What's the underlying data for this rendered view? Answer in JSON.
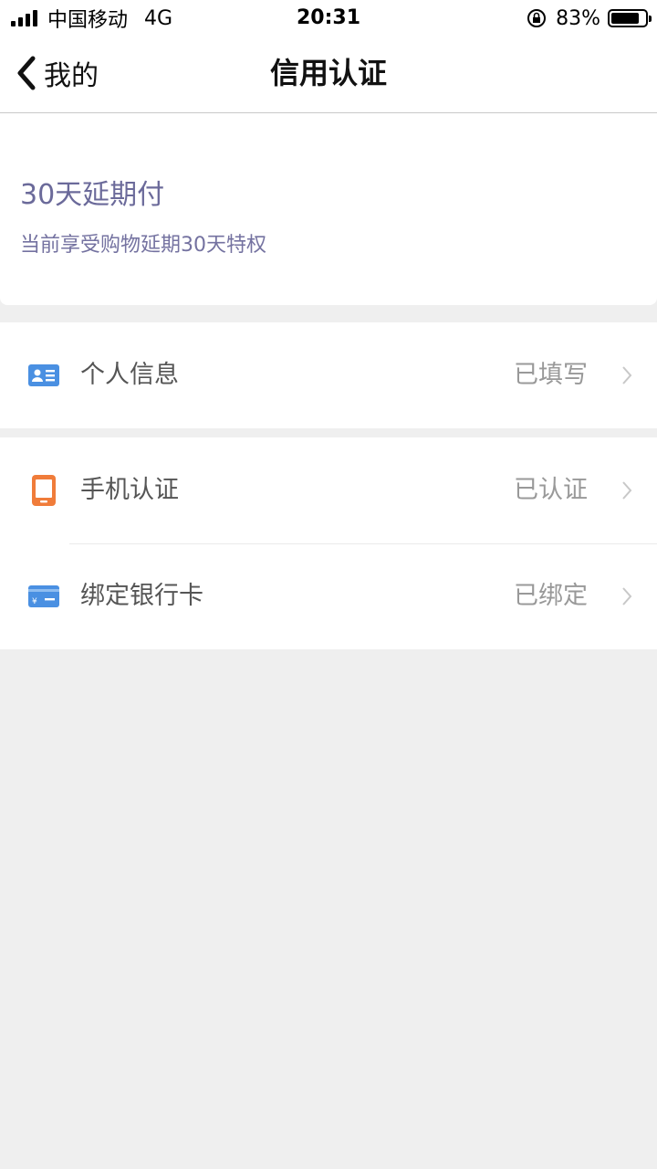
{
  "status_bar": {
    "carrier": "中国移动",
    "network": "4G",
    "time": "20:31",
    "battery_percent": "83%",
    "battery_level": 0.83
  },
  "nav": {
    "back_label": "我的",
    "title": "信用认证"
  },
  "credit": {
    "title": "30天延期付",
    "subtitle": "当前享受购物延期30天特权"
  },
  "items": [
    {
      "label": "个人信息",
      "status": "已填写",
      "icon": "id-card-icon",
      "color": "#4a90e2"
    },
    {
      "label": "手机认证",
      "status": "已认证",
      "icon": "phone-icon",
      "color": "#f07c3a"
    },
    {
      "label": "绑定银行卡",
      "status": "已绑定",
      "icon": "bank-card-icon",
      "color": "#4a90e2"
    }
  ],
  "colors": {
    "page_bg": "#efefef",
    "credit_text": "#6b6a9a",
    "status_text": "#999999"
  }
}
